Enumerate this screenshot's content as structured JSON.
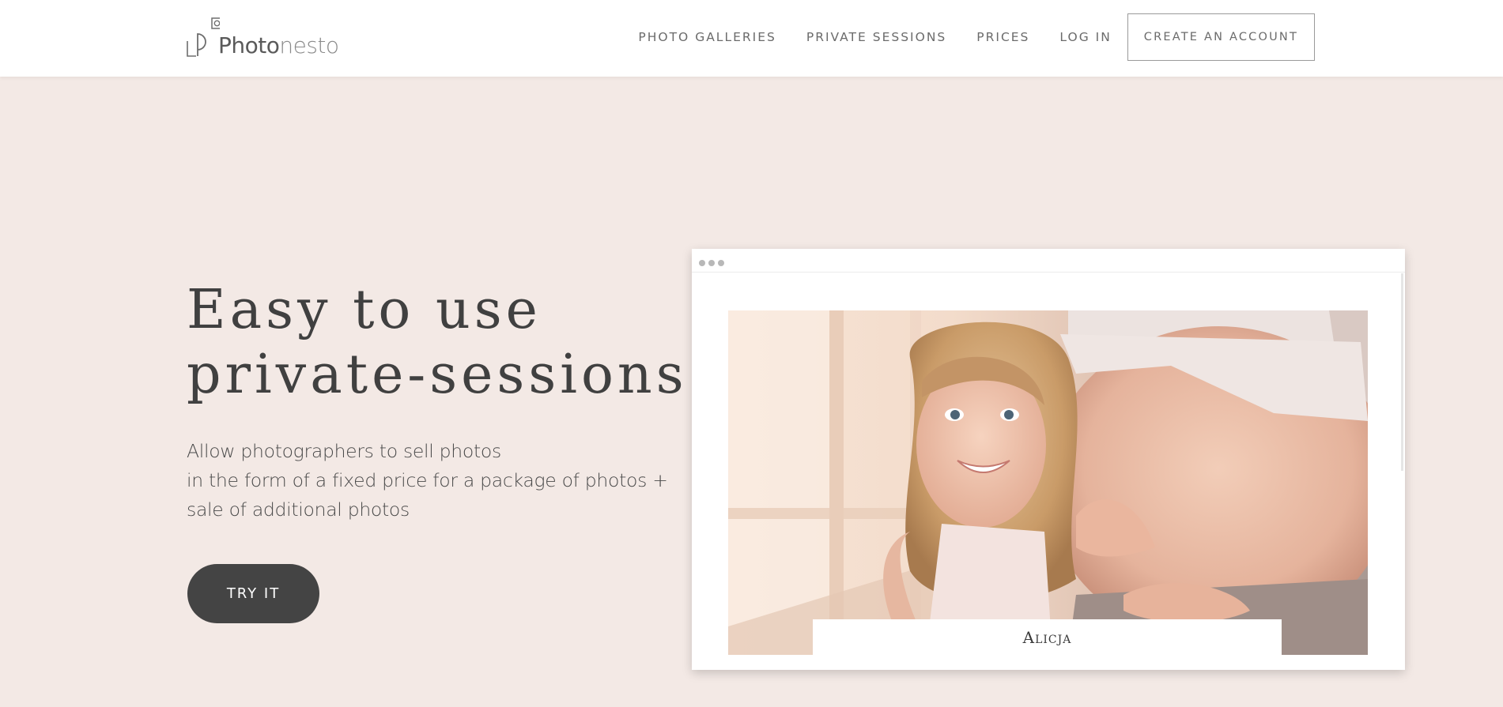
{
  "brand": {
    "name_bold": "Photo",
    "name_light": "nesto"
  },
  "nav": {
    "items": [
      "PHOTO GALLERIES",
      "PRIVATE SESSIONS",
      "PRICES",
      "LOG IN"
    ],
    "cta": "CREATE AN ACCOUNT"
  },
  "hero": {
    "title_lines": [
      "Easy to use",
      "private-sessions"
    ],
    "description_lines": [
      "Allow photographers to sell photos",
      "in the form of a fixed price for a package of photos +",
      "sale of additional photos"
    ],
    "button": "TRY IT"
  },
  "preview": {
    "caption": "Alicja"
  },
  "colors": {
    "background": "#f3e9e5",
    "header": "#ffffff",
    "button": "#444444",
    "text": "#404040"
  }
}
